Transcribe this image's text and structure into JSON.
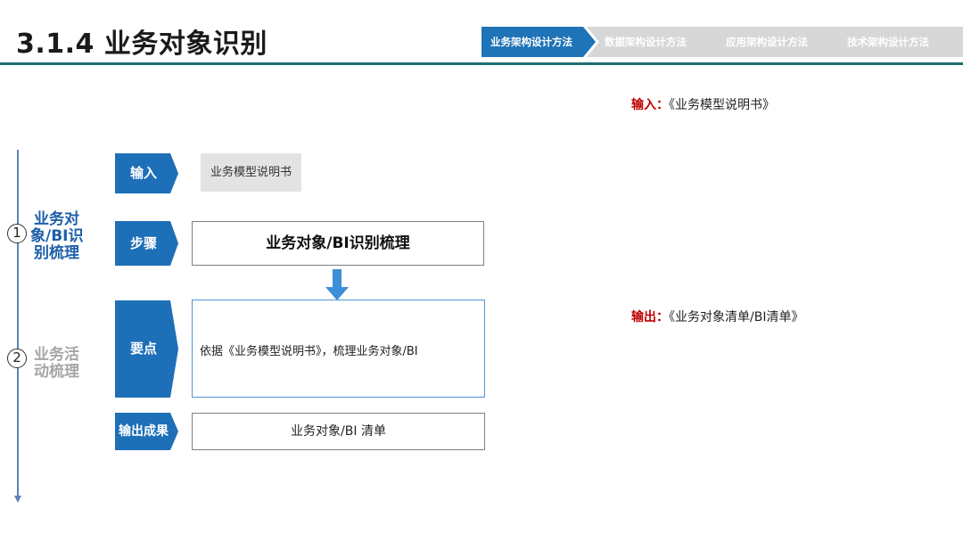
{
  "header": {
    "title": "3.1.4 业务对象识别",
    "nav_steps": [
      {
        "label": "业务架构设计方法",
        "active": true
      },
      {
        "label": "数据架构设计方法",
        "active": false
      },
      {
        "label": "应用架构设计方法",
        "active": false
      },
      {
        "label": "技术架构设计方法",
        "active": false
      }
    ]
  },
  "stages": [
    {
      "number": "1",
      "lines": [
        "业务对",
        "象/BI识",
        "别梳理"
      ]
    },
    {
      "number": "2",
      "lines": [
        "业务活",
        "动梳理"
      ]
    }
  ],
  "flow": {
    "input_tag": "输入",
    "input_value": "业务模型说明书",
    "steps_tag": "步骤",
    "steps_value": "业务对象/BI识别梳理",
    "keypoints_tag": "要点",
    "keypoints_value": "依据《业务模型说明书》，梳理业务对象/BI",
    "output_tag": "输出成果",
    "output_value": "业务对象/BI 清单"
  },
  "right_panel": {
    "input_label": "输入：",
    "input_value": "《业务模型说明书》",
    "output_label": "输出：",
    "output_value": "《业务对象清单/BI清单》"
  },
  "colors": {
    "accent_blue": "#1d6fb8",
    "nav_active": "#1f73b7",
    "nav_inactive": "#d7d7d7",
    "header_rule": "#1e6f74",
    "label_red": "#c00000",
    "arrow_blue": "#3d8fd8",
    "timeline_blue": "#5b82b8"
  }
}
